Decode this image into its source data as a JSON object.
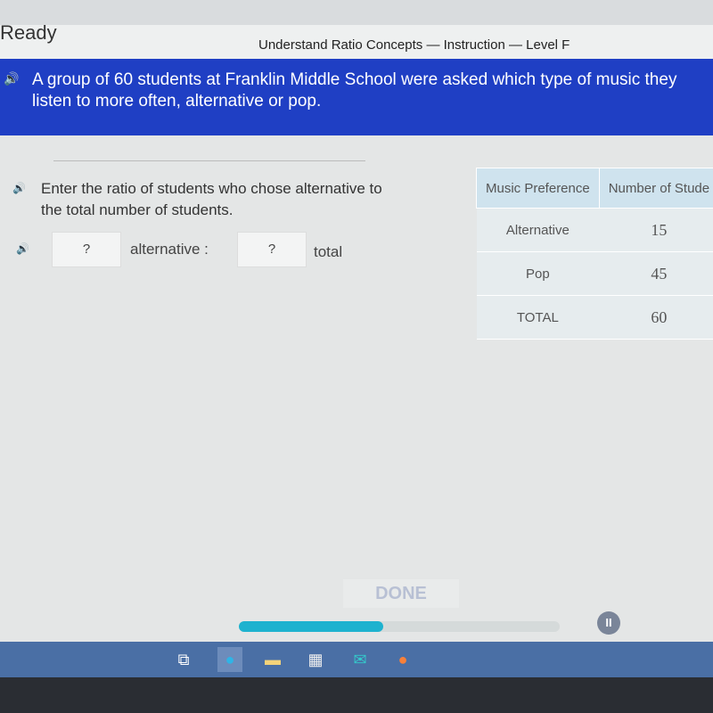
{
  "app": {
    "logo": "Ready",
    "lesson_title": "Understand Ratio Concepts — Instruction — Level F"
  },
  "banner": {
    "text": "A group of 60 students at Franklin Middle School were asked which type of music they listen to more often, alternative or pop."
  },
  "question": {
    "text": "Enter the ratio of students who chose alternative to the total number of students.",
    "input1": "?",
    "label1": "alternative :",
    "input2": "?",
    "label2": "total"
  },
  "table": {
    "headers": [
      "Music Preference",
      "Number of Stude"
    ],
    "rows": [
      [
        "Alternative",
        "15"
      ],
      [
        "Pop",
        "45"
      ],
      [
        "TOTAL",
        "60"
      ]
    ]
  },
  "footer": {
    "done_label": "DONE",
    "progress_percent": 45,
    "progress_color": "#1eb2cf"
  },
  "taskbar": {
    "icons": [
      "task-view-icon",
      "edge-icon",
      "file-explorer-icon",
      "store-icon",
      "mail-icon",
      "firefox-icon"
    ]
  }
}
